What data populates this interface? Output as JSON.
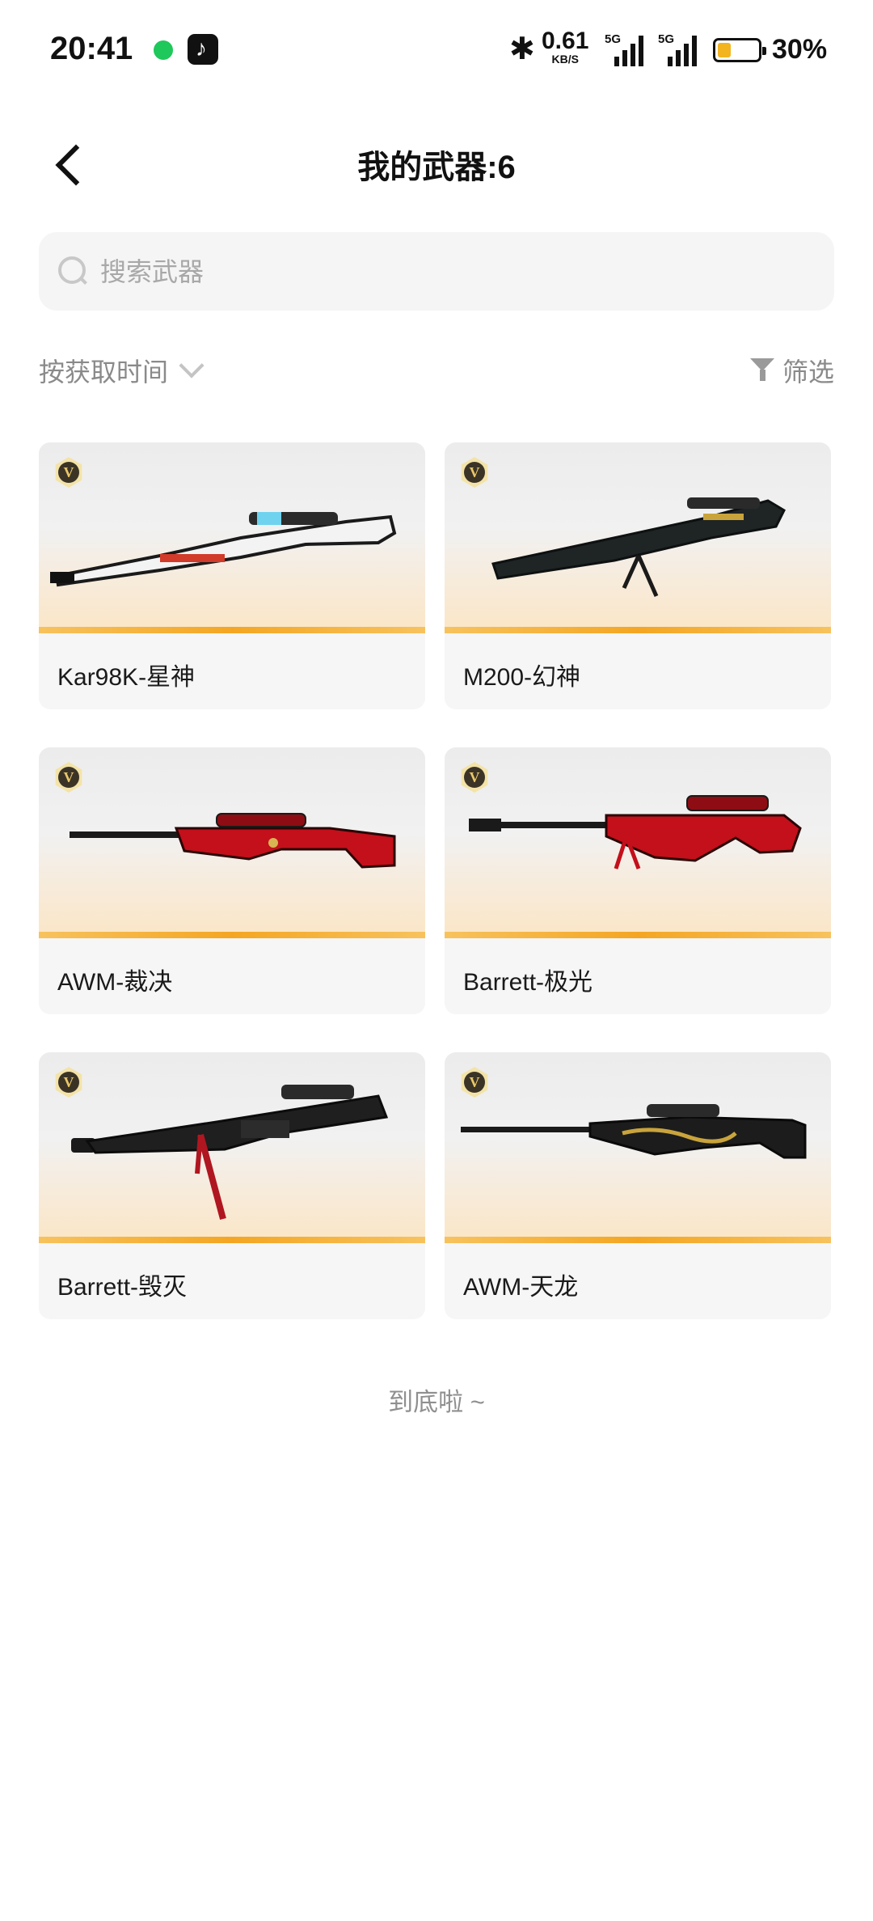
{
  "status_bar": {
    "time": "20:41",
    "net_speed": "0.61",
    "net_unit": "KB/S",
    "sim1_label": "5G",
    "sim2_label": "5G",
    "battery": "30%"
  },
  "header": {
    "title": "我的武器:6"
  },
  "search": {
    "placeholder": "搜索武器"
  },
  "toolbar": {
    "sort_label": "按获取时间",
    "filter_label": "筛选"
  },
  "weapons": [
    {
      "name": "Kar98K-星神",
      "badge": "V",
      "accent": "#ffffff"
    },
    {
      "name": "M200-幻神",
      "badge": "V",
      "accent": "#c9a43c"
    },
    {
      "name": "AWM-裁决",
      "badge": "V",
      "accent": "#c3101b"
    },
    {
      "name": "Barrett-极光",
      "badge": "V",
      "accent": "#c3101b"
    },
    {
      "name": "Barrett-毁灭",
      "badge": "V",
      "accent": "#b01620"
    },
    {
      "name": "AWM-天龙",
      "badge": "V",
      "accent": "#c9a43c"
    }
  ],
  "footer": {
    "end_text": "到底啦 ~"
  }
}
